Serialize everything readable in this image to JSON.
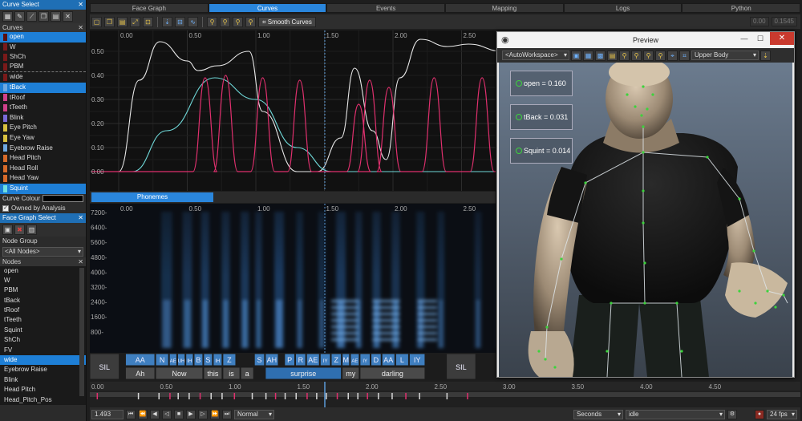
{
  "left_panel": {
    "curve_select_title": "Curve Select",
    "curves_header": "Curves",
    "curves": [
      {
        "label": "open",
        "color": "#5a1010",
        "selected": true
      },
      {
        "label": "W",
        "color": "#7a1a1a"
      },
      {
        "label": "ShCh",
        "color": "#7a1a1a"
      },
      {
        "label": "PBM",
        "color": "#7a1a1a"
      },
      {
        "label": "wide",
        "color": "#7a1a1a"
      },
      {
        "label": "tBack",
        "color": "#6fa8e0",
        "selected": true
      },
      {
        "label": "tRoof",
        "color": "#d0408a"
      },
      {
        "label": "tTeeth",
        "color": "#d0408a"
      },
      {
        "label": "Blink",
        "color": "#7a6ad8"
      },
      {
        "label": "Eye Pitch",
        "color": "#d8c040"
      },
      {
        "label": "Eye Yaw",
        "color": "#d8c040"
      },
      {
        "label": "Eyebrow Raise",
        "color": "#6fa8e0"
      },
      {
        "label": "Head Pitch",
        "color": "#d66a2a"
      },
      {
        "label": "Head Roll",
        "color": "#d66a2a"
      },
      {
        "label": "Head Yaw",
        "color": "#d66a2a"
      },
      {
        "label": "Squint",
        "color": "#6fe0e0",
        "selected": true
      }
    ],
    "curve_colour_label": "Curve Colour",
    "owned_by_analysis": "Owned by Analysis",
    "face_graph_select_title": "Face Graph Select",
    "node_group_label": "Node Group",
    "node_group_value": "<All Nodes>",
    "nodes_header": "Nodes",
    "nodes": [
      "open",
      "W",
      "PBM",
      "tBack",
      "tRoof",
      "tTeeth",
      "Squint",
      "ShCh",
      "FV",
      "wide",
      "Eyebrow Raise",
      "Blink",
      "Head Pitch",
      "Head_Pitch_Pos"
    ],
    "nodes_selected": "wide"
  },
  "tabs": [
    "Face Graph",
    "Curves",
    "Events",
    "Mapping",
    "Logs",
    "Python"
  ],
  "active_tab": "Curves",
  "toolbar": {
    "smooth_curves_label": "Smooth Curves",
    "field_a": "0.00",
    "field_b": "0.1545"
  },
  "curves_axis": {
    "x_ticks": [
      "0.00",
      "0.50",
      "1.00",
      "1.50",
      "2.00",
      "2.50"
    ],
    "y_ticks": [
      "0.50",
      "0.40",
      "0.30",
      "0.20",
      "0.10",
      "0.00"
    ]
  },
  "phonemes_tab": "Phonemes",
  "spectrogram_axis": {
    "x_ticks": [
      "0.00",
      "0.50",
      "1.00",
      "1.50",
      "2.00",
      "2.50"
    ],
    "y_ticks": [
      "7200-",
      "6400-",
      "5600-",
      "4800-",
      "4000-",
      "3200-",
      "2400-",
      "1600-",
      "800-"
    ]
  },
  "phonemes_top": [
    "SIL",
    "AA",
    "N",
    "AE",
    "UH",
    "IH",
    "B",
    "S",
    "IH",
    "Z",
    "S",
    "AH",
    "P",
    "R",
    "AE",
    "IY",
    "Z",
    "M",
    "AE",
    "IY",
    "D",
    "AA",
    "L",
    "IY",
    "SIL"
  ],
  "phonemes_words": [
    "Ah",
    "Now",
    "this",
    "is",
    "a",
    "surprise",
    "my",
    "darling"
  ],
  "timeline_ticks": [
    "0.00",
    "0.50",
    "1.00",
    "1.50",
    "2.00",
    "2.50",
    "3.00",
    "3.50",
    "4.00",
    "4.50"
  ],
  "bottom_bar": {
    "time_value": "1.493",
    "play_mode": "Normal",
    "units": "Seconds",
    "state": "idle",
    "fps": "24 fps"
  },
  "preview": {
    "title": "Preview",
    "workspace": "<AutoWorkspace>",
    "body_part": "Upper Body",
    "morphs": [
      {
        "name": "open",
        "value": "0.160"
      },
      {
        "name": "tBack",
        "value": "0.031"
      },
      {
        "name": "Squint",
        "value": "0.014"
      }
    ]
  },
  "colors": {
    "accent": "#2a86dc",
    "curve_white": "#e8e8e8",
    "curve_cyan": "#6fd8d8",
    "curve_pink": "#e0306e",
    "bone_green": "#3cd33c"
  }
}
